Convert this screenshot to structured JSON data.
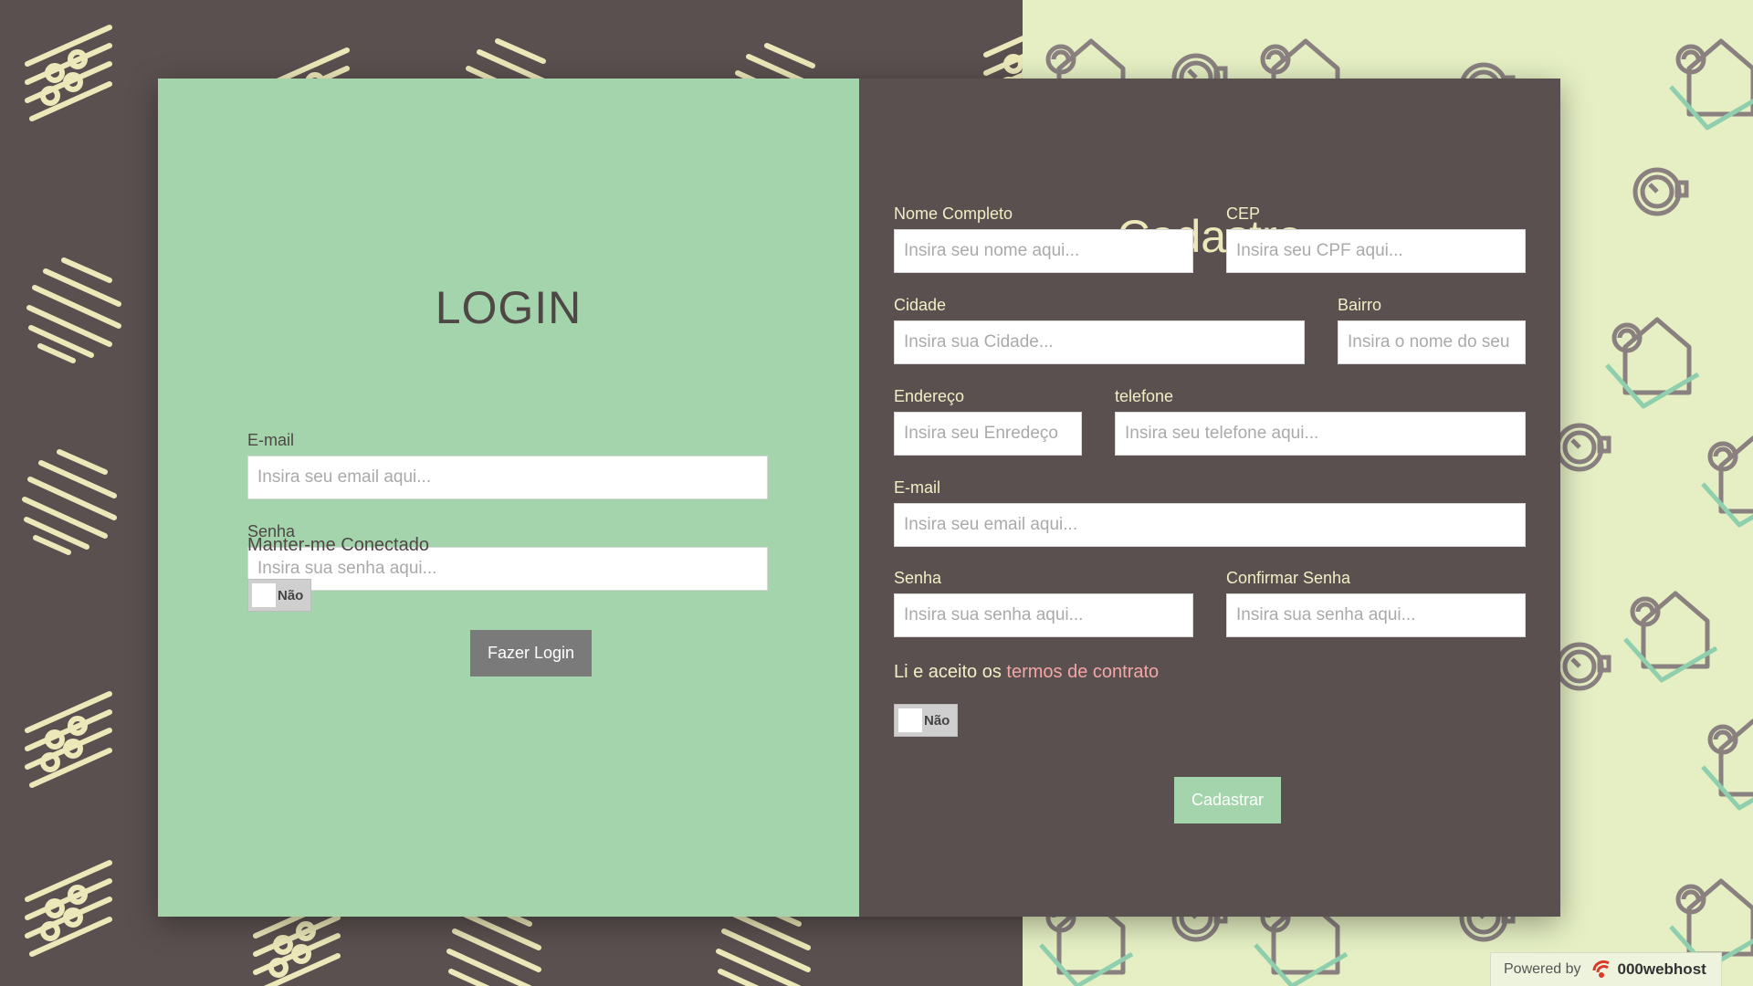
{
  "login": {
    "title": "LOGIN",
    "email_label": "E-mail",
    "email_placeholder": "Insira seu email aqui...",
    "password_label": "Senha",
    "password_placeholder": "Insira sua senha aqui...",
    "keep_connected": "Manter-me Conectado",
    "toggle_label": "Não",
    "submit": "Fazer Login"
  },
  "register": {
    "title": "Cadastro",
    "name_label": "Nome Completo",
    "name_placeholder": "Insira seu nome aqui...",
    "cep_label": "CEP",
    "cep_placeholder": "Insira seu CPF aqui...",
    "city_label": "Cidade",
    "city_placeholder": "Insira sua Cidade...",
    "district_label": "Bairro",
    "district_placeholder": "Insira o nome do seu bairro",
    "address_label": "Endereço",
    "address_placeholder": "Insira seu Enredeço",
    "phone_label": "telefone",
    "phone_placeholder": "Insira seu telefone aqui...",
    "email_label": "E-mail",
    "email_placeholder": "Insira seu email aqui...",
    "password_label": "Senha",
    "password_placeholder": "Insira sua senha aqui...",
    "confirm_label": "Confirmar Senha",
    "confirm_placeholder": "Insira sua senha aqui...",
    "terms_prefix": "Li e aceito os ",
    "terms_link": "termos de contrato",
    "toggle_label": "Não",
    "submit": "Cadastrar"
  },
  "footer": {
    "powered_by": "Powered by",
    "brand": "000webhost"
  },
  "colors": {
    "login_bg": "#a3d4ab",
    "register_bg": "#5b5050",
    "right_bg": "#e5efc3",
    "accent_pink": "#f3a6a6",
    "pattern_cream": "#ece8b9"
  },
  "icons": {
    "left_pattern": [
      "equalizer-icon",
      "stripes-icon"
    ],
    "right_pattern": [
      "house-icon",
      "stopwatch-icon"
    ]
  }
}
